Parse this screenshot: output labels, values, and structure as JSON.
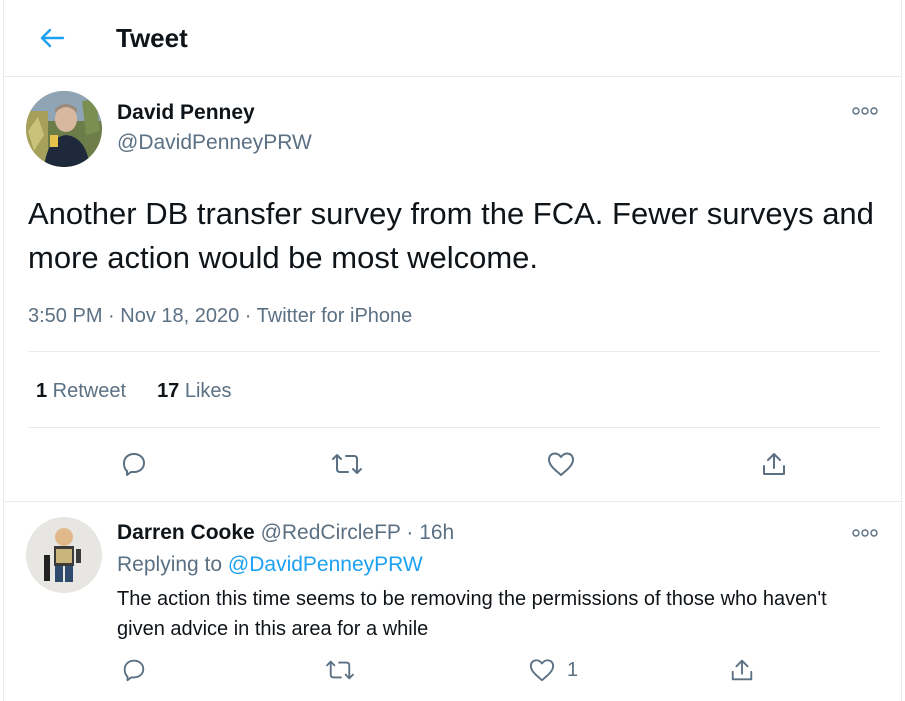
{
  "header": {
    "title": "Tweet",
    "back_icon": "arrow-left-icon"
  },
  "colors": {
    "accent": "#1da1f2",
    "text_primary": "#0f1419",
    "text_secondary": "#5b7083",
    "divider": "#e6ecf0"
  },
  "main_tweet": {
    "author_name": "David Penney",
    "author_handle": "@DavidPenneyPRW",
    "text": "Another DB transfer survey from the FCA. Fewer surveys and more action would be most welcome.",
    "time": "3:50 PM",
    "separator": " · ",
    "date": "Nov 18, 2020",
    "source": "Twitter for iPhone",
    "retweet_count": "1",
    "retweet_label": " Retweet",
    "like_count": "17",
    "like_label": " Likes",
    "actions": [
      "reply-icon",
      "retweet-icon",
      "like-icon",
      "share-icon"
    ]
  },
  "reply_tweet": {
    "author_name": "Darren Cooke",
    "author_handle": "@RedCircleFP",
    "separator": " · ",
    "time": "16h",
    "replying_prefix": "Replying to ",
    "replying_to": "@DavidPenneyPRW",
    "text": "The action this time seems to be removing the permissions of those who haven't given advice in this area for a while",
    "like_count": "1",
    "actions": [
      "reply-icon",
      "retweet-icon",
      "like-icon",
      "share-icon"
    ]
  }
}
